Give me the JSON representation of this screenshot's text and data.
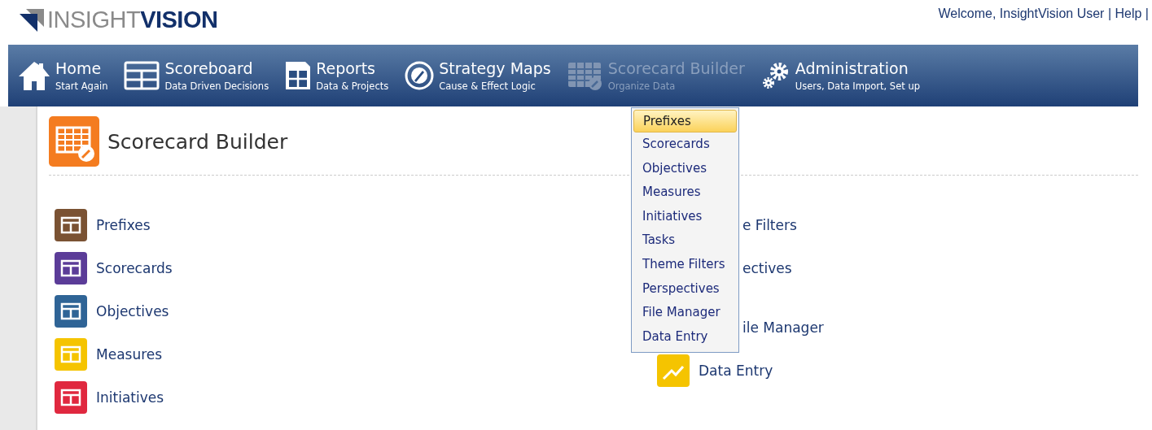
{
  "logo": {
    "light": "INSIGHT",
    "bold": "VISION"
  },
  "user_bar": "Welcome, InsightVision User | Help |",
  "nav": [
    {
      "title": "Home",
      "subtitle": "Start Again",
      "selected": false
    },
    {
      "title": "Scoreboard",
      "subtitle": "Data Driven Decisions",
      "selected": false
    },
    {
      "title": "Reports",
      "subtitle": "Data & Projects",
      "selected": false
    },
    {
      "title": "Strategy Maps",
      "subtitle": "Cause & Effect Logic",
      "selected": false
    },
    {
      "title": "Scorecard Builder",
      "subtitle": "Organize Data",
      "selected": true
    },
    {
      "title": "Administration",
      "subtitle": "Users, Data Import, Set up",
      "selected": false
    }
  ],
  "dropdown": [
    {
      "label": "Prefixes",
      "selected": true
    },
    {
      "label": "Scorecards",
      "selected": false
    },
    {
      "label": "Objectives",
      "selected": false
    },
    {
      "label": "Measures",
      "selected": false
    },
    {
      "label": "Initiatives",
      "selected": false
    },
    {
      "label": "Tasks",
      "selected": false
    },
    {
      "label": "Theme Filters",
      "selected": false
    },
    {
      "label": "Perspectives",
      "selected": false
    },
    {
      "label": "File Manager",
      "selected": false
    },
    {
      "label": "Data Entry",
      "selected": false
    }
  ],
  "page_title": "Scorecard Builder",
  "left_items": [
    {
      "label": "Prefixes",
      "color": "#7a5233"
    },
    {
      "label": "Scorecards",
      "color": "#5b3c98"
    },
    {
      "label": "Objectives",
      "color": "#2f6496"
    },
    {
      "label": "Measures",
      "color": "#f5c400"
    },
    {
      "label": "Initiatives",
      "color": "#e0283f"
    }
  ],
  "right_items": [
    {
      "label": "e Filters",
      "kind": "hidden"
    },
    {
      "label": "ectives",
      "kind": "hidden"
    },
    {
      "label": "ile Manager",
      "kind": "partial"
    },
    {
      "label": "Data Entry",
      "kind": "full",
      "color": "#f5c400"
    }
  ]
}
